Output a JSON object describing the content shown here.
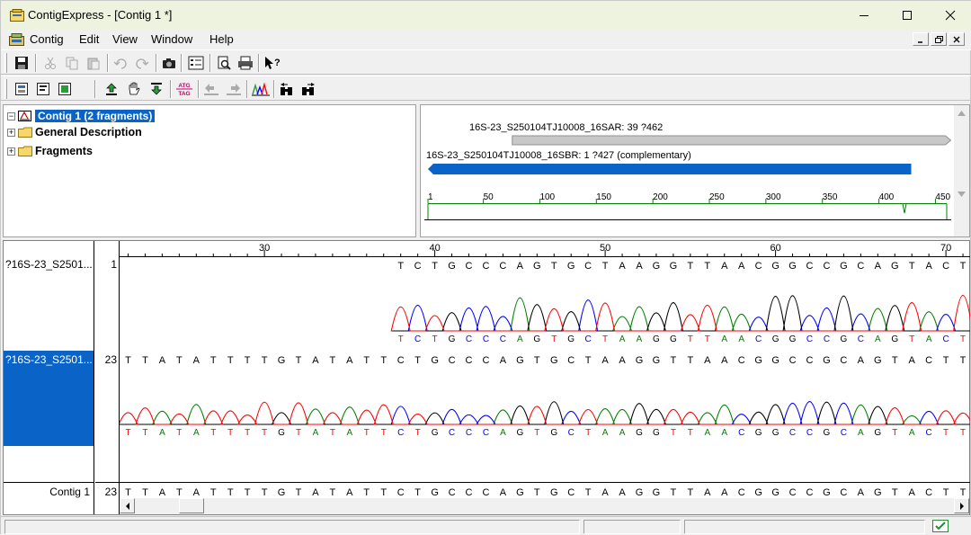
{
  "window": {
    "title": "ContigExpress - [Contig 1 *]",
    "icon": "contigexpress-app-icon"
  },
  "menu": {
    "items": [
      "Contig",
      "Edit",
      "View",
      "Window",
      "Help"
    ]
  },
  "toolbar1": {
    "buttons": [
      "save-icon",
      "cut-icon",
      "copy-icon",
      "paste-icon",
      "undo-icon",
      "redo-icon",
      "camera-icon",
      "properties-icon",
      "print-preview-icon",
      "print-icon",
      "context-help-icon"
    ]
  },
  "toolbar2": {
    "buttons": [
      "view-mode-1-icon",
      "view-mode-2-icon",
      "view-mode-3-icon",
      "move-up-icon",
      "hand-icon",
      "move-down-icon",
      "atg-tag-icon",
      "shift-left-icon",
      "shift-right-icon",
      "chromatogram-icon",
      "find-prev-icon",
      "find-next-icon"
    ],
    "atg_tag_text": [
      "ATG",
      "TAG"
    ]
  },
  "tree": {
    "root": "Contig 1 (2 fragments)",
    "children": [
      "General Description",
      "Fragments"
    ]
  },
  "overview": {
    "fragment1_label": "16S-23_S250104TJ10008_16SAR: 39 ?462",
    "fragment2_label": "16S-23_S250104TJ10008_16SBR: 1 ?427 (complementary)",
    "ruler_ticks": [
      "1",
      "50",
      "100",
      "150",
      "200",
      "250",
      "300",
      "350",
      "400",
      "450"
    ],
    "fragment1_range": [
      39,
      462
    ],
    "fragment2_range": [
      1,
      427
    ],
    "ruler_max": 460,
    "colors": {
      "fragment1": "#c8c8c8",
      "fragment2": "#0a64c8",
      "ruler": "#008000"
    }
  },
  "alignment": {
    "ruler_ticks": [
      "30",
      "40",
      "50",
      "60",
      "70"
    ],
    "rows": [
      {
        "name": "?16S-23_S2501...",
        "start": "1"
      },
      {
        "name": "?16S-23_S2501...",
        "start": "23"
      }
    ],
    "consensus": {
      "name": "Contig 1",
      "start": "23"
    },
    "seq_row1_top": "TCTGCCCAGTGCTAAGGTTAACGGCCGCAGTACTT",
    "seq_row1_bottom": "TCTGCCCAGTGCTAAGGTTAACGGCCGCAGTACTT",
    "seq_row2_top": "TTATATTTTGTATATTCTGCCCAGTGCTAAGGTTAACGGCCGCAGTACTT",
    "seq_row2_bottom": "TTATATTTTGTATATTCTGCCCAGTGCTAAGGTTAACGGCCGCAGTACTT",
    "seq_consensus": "TTATATTTTGTATATTCTGCCCAGTGCTAAGGTTAACGGCCGCAGTACTT",
    "base_colors": {
      "A": "#008000",
      "C": "#0000ff",
      "G": "#000000",
      "T": "#ff0000"
    }
  },
  "status": {
    "icon": "status-ok-icon"
  }
}
